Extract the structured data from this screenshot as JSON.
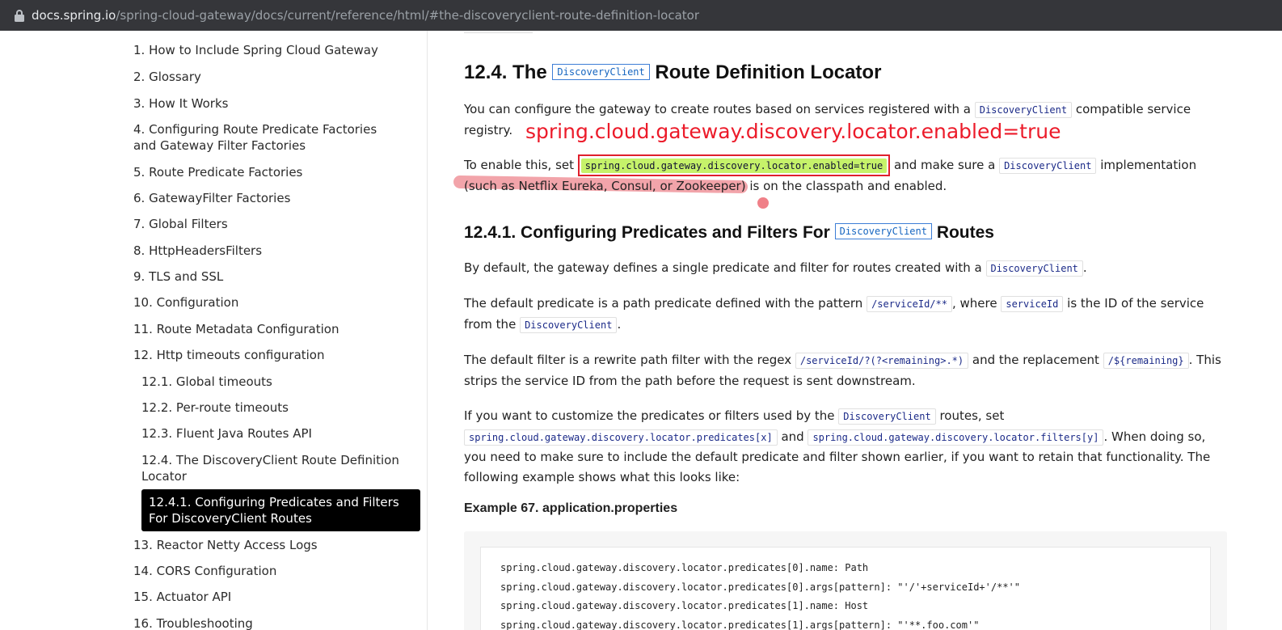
{
  "browser": {
    "url_host": "docs.spring.io",
    "url_path": "/spring-cloud-gateway/docs/current/reference/html/#the-discoveryclient-route-definition-locator",
    "lock_icon": "lock-icon"
  },
  "sidebar": {
    "items": [
      "1. How to Include Spring Cloud Gateway",
      "2. Glossary",
      "3. How It Works",
      "4. Configuring Route Predicate Factories and Gateway Filter Factories",
      "5. Route Predicate Factories",
      "6. GatewayFilter Factories",
      "7. Global Filters",
      "8. HttpHeadersFilters",
      "9. TLS and SSL",
      "10. Configuration",
      "11. Route Metadata Configuration",
      "12. Http timeouts configuration",
      "12.1. Global timeouts",
      "12.2. Per-route timeouts",
      "12.3. Fluent Java Routes API",
      "12.4. The DiscoveryClient Route Definition Locator",
      "12.4.1. Configuring Predicates and Filters For DiscoveryClient Routes",
      "13. Reactor Netty Access Logs",
      "14. CORS Configuration",
      "15. Actuator API",
      "16. Troubleshooting"
    ]
  },
  "content": {
    "h_12_4": {
      "pre": "12.4. The ",
      "code": "DiscoveryClient",
      "post": " Route Definition Locator"
    },
    "p1": {
      "pre": "You can configure the gateway to create routes based on services registered with a ",
      "code": "DiscoveryClient",
      "post": " compatible service registry."
    },
    "annotation": "spring.cloud.gateway.discovery.locator.enabled=true",
    "p2": {
      "pre": "To enable this, set ",
      "code": "spring.cloud.gateway.discovery.locator.enabled=true",
      "mid": " and make sure a ",
      "code2": "DiscoveryClient",
      "post": " implementation (such as Netflix Eureka, Consul, or Zookeeper) is on the classpath and enabled."
    },
    "h_12_4_1": {
      "pre": "12.4.1. Configuring Predicates and Filters For ",
      "code": "DiscoveryClient",
      "post": " Routes"
    },
    "p3": {
      "pre": "By default, the gateway defines a single predicate and filter for routes created with a ",
      "code": "DiscoveryClient",
      "post": "."
    },
    "p4": {
      "pre": "The default predicate is a path predicate defined with the pattern ",
      "code": "/serviceId/**",
      "mid": ", where ",
      "code2": "serviceId",
      "mid2": " is the ID of the service from the ",
      "code3": "DiscoveryClient",
      "post": "."
    },
    "p5": {
      "pre": "The default filter is a rewrite path filter with the regex ",
      "code": "/serviceId/?(?<remaining>.*)",
      "mid": " and the replacement ",
      "code2": "/${remaining}",
      "post": ". This strips the service ID from the path before the request is sent downstream."
    },
    "p6": {
      "pre": "If you want to customize the predicates or filters used by the ",
      "code": "DiscoveryClient",
      "mid": " routes, set ",
      "code2": "spring.cloud.gateway.discovery.locator.predicates[x]",
      "mid2": " and ",
      "code3": "spring.cloud.gateway.discovery.locator.filters[y]",
      "post": ". When doing so, you need to make sure to include the default predicate and filter shown earlier, if you want to retain that functionality. The following example shows what this looks like:"
    },
    "example_title": "Example 67. application.properties",
    "code_lines": [
      "spring.cloud.gateway.discovery.locator.predicates[0].name: Path",
      "spring.cloud.gateway.discovery.locator.predicates[0].args[pattern]: \"'/'+serviceId+'/**'\"",
      "spring.cloud.gateway.discovery.locator.predicates[1].name: Host",
      "spring.cloud.gateway.discovery.locator.predicates[1].args[pattern]: \"'**.foo.com'\""
    ]
  },
  "colors": {
    "active_toc_bg": "#000000",
    "annotation_red": "#ec1b2a",
    "highlight_green": "#c6f26a",
    "code_link_blue": "#1565c0"
  }
}
